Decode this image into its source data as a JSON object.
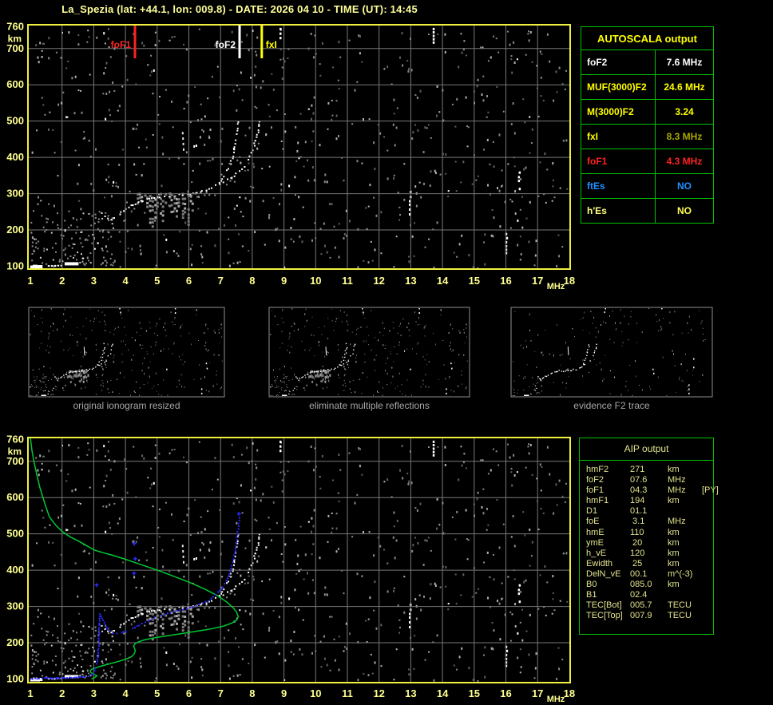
{
  "title": "La_Spezia (lat: +44.1, lon: 009.8) - DATE: 2026 04 10 - TIME (UT): 14:45",
  "colors": {
    "background": "#000000",
    "plot_border": "#F0F040",
    "grid": "#787878",
    "axis_text": "#FFFF90",
    "title_text": "#FFFF99",
    "caption_text": "#A6A6A6",
    "table_border": "#00C000",
    "green_profile": "#00C832",
    "blue_trace": "#2A2AFF",
    "trace_white": "#FFFFFF",
    "thumb_border": "#909090"
  },
  "axes": {
    "x_tick_labels": [
      "1",
      "2",
      "3",
      "4",
      "5",
      "6",
      "7",
      "8",
      "9",
      "10",
      "11",
      "12",
      "13",
      "14",
      "15",
      "16",
      "17",
      "18"
    ],
    "y_tick_labels": [
      "760",
      "700",
      "600",
      "500",
      "400",
      "300",
      "200",
      "100"
    ],
    "x_unit": "MHz",
    "y_unit": "km"
  },
  "autoscala": {
    "title": "AUTOSCALA output",
    "rows": [
      {
        "label": "foF2",
        "value": "7.6 MHz",
        "label_color": "#FFFFFF",
        "value_color": "#FFFFFF"
      },
      {
        "label": "MUF(3000)F2",
        "value": "24.6 MHz",
        "label_color": "#FFFF00",
        "value_color": "#FFFF00"
      },
      {
        "label": "M(3000)F2",
        "value": "3.24",
        "label_color": "#FFFF00",
        "value_color": "#FFFF00"
      },
      {
        "label": "fxI",
        "value": "8.3 MHz",
        "label_color": "#FFFF00",
        "value_color": "#A8A800"
      },
      {
        "label": "foF1",
        "value": "4.3 MHz",
        "label_color": "#FF2222",
        "value_color": "#FF2222"
      },
      {
        "label": "ftEs",
        "value": "NO",
        "label_color": "#1E90FF",
        "value_color": "#1E90FF"
      },
      {
        "label": "h'Es",
        "value": "NO",
        "label_color": "#FFFF80",
        "value_color": "#FFFF55"
      }
    ]
  },
  "aip": {
    "title": "AIP output",
    "rows": [
      {
        "label": "hmF2",
        "value": "271",
        "unit": "km",
        "extra": ""
      },
      {
        "label": "foF2",
        "value": "07.6",
        "unit": "MHz",
        "extra": ""
      },
      {
        "label": "foF1",
        "value": "04.3",
        "unit": "MHz",
        "extra": "[PY]"
      },
      {
        "label": "hmF1",
        "value": "194",
        "unit": "km",
        "extra": ""
      },
      {
        "label": "D1",
        "value": "01.1",
        "unit": "",
        "extra": ""
      },
      {
        "label": "foE",
        "value": " 3.1",
        "unit": "MHz",
        "extra": ""
      },
      {
        "label": "hmE",
        "value": "110",
        "unit": "km",
        "extra": ""
      },
      {
        "label": "ymE",
        "value": " 20",
        "unit": "km",
        "extra": ""
      },
      {
        "label": "h_vE",
        "value": "120",
        "unit": "km",
        "extra": ""
      },
      {
        "label": "Ewidth",
        "value": " 25",
        "unit": "km",
        "extra": ""
      },
      {
        "label": "DelN_vE",
        "value": "00.1",
        "unit": "m^(-3)",
        "extra": ""
      },
      {
        "label": "B0",
        "value": "085.0",
        "unit": "km",
        "extra": ""
      },
      {
        "label": "B1",
        "value": "02.4",
        "unit": "",
        "extra": ""
      },
      {
        "label": "TEC[Bot]",
        "value": "005.7",
        "unit": "TECU",
        "extra": ""
      },
      {
        "label": "TEC[Top]",
        "value": "007.9",
        "unit": "TECU",
        "extra": ""
      }
    ]
  },
  "thumbnails": [
    {
      "caption": "original ionogram resized"
    },
    {
      "caption": "eliminate multiple reflections"
    },
    {
      "caption": "evidence F2 trace"
    }
  ],
  "chart_data": [
    {
      "id": "main-ionogram",
      "type": "scatter",
      "title": "",
      "xlabel": "MHz",
      "ylabel": "km",
      "xlim": [
        1,
        18
      ],
      "ylim": [
        100,
        760
      ],
      "grid": true,
      "x_ticks": [
        1,
        2,
        3,
        4,
        5,
        6,
        7,
        8,
        9,
        10,
        11,
        12,
        13,
        14,
        15,
        16,
        17,
        18
      ],
      "y_ticks": [
        760,
        700,
        600,
        500,
        400,
        300,
        200,
        100
      ],
      "markers": [
        {
          "label": "foF1",
          "freq_mhz": 4.3,
          "color": "#FF2222",
          "label_side": "left"
        },
        {
          "label": "foF2",
          "freq_mhz": 7.6,
          "color": "#FFFFFF",
          "label_side": "left"
        },
        {
          "label": "fxI",
          "freq_mhz": 8.3,
          "color": "#FFFF00",
          "label_side": "right"
        }
      ],
      "series": {
        "e_blobs": [
          [
            1.02,
            100
          ],
          [
            1.1,
            102
          ],
          [
            1.18,
            100
          ],
          [
            1.26,
            101
          ]
        ],
        "e_dots": [
          [
            1.55,
            103
          ],
          [
            1.65,
            103
          ],
          [
            1.75,
            103
          ],
          [
            1.85,
            104
          ],
          [
            1.95,
            104
          ],
          [
            2.63,
            124
          ],
          [
            3.0,
            150
          ],
          [
            3.1,
            166
          ]
        ],
        "es_bar": {
          "f_start": 2.08,
          "f_end": 2.52,
          "km": 109
        },
        "f_trace": [
          [
            3.25,
            248
          ],
          [
            3.32,
            238
          ],
          [
            3.42,
            232
          ],
          [
            3.52,
            229
          ],
          [
            3.62,
            234
          ],
          [
            3.72,
            241
          ],
          [
            3.85,
            250
          ],
          [
            4.0,
            260
          ],
          [
            4.15,
            268
          ],
          [
            4.3,
            275
          ],
          [
            4.45,
            281
          ],
          [
            4.6,
            286
          ],
          [
            4.75,
            289
          ],
          [
            4.9,
            292
          ],
          [
            5.05,
            294
          ],
          [
            5.2,
            295
          ],
          [
            5.35,
            296
          ],
          [
            5.5,
            297
          ],
          [
            5.65,
            298
          ],
          [
            5.8,
            299
          ],
          [
            5.95,
            300
          ],
          [
            6.1,
            302
          ],
          [
            6.25,
            305
          ],
          [
            6.4,
            308
          ],
          [
            6.55,
            313
          ],
          [
            6.7,
            319
          ],
          [
            6.82,
            326
          ],
          [
            6.94,
            334
          ],
          [
            7.05,
            344
          ],
          [
            7.15,
            357
          ],
          [
            7.24,
            373
          ],
          [
            7.32,
            392
          ],
          [
            7.39,
            414
          ],
          [
            7.45,
            440
          ],
          [
            7.49,
            466
          ],
          [
            7.52,
            492
          ],
          [
            7.54,
            510
          ]
        ],
        "x_trace": [
          [
            6.95,
            330
          ],
          [
            7.12,
            337
          ],
          [
            7.3,
            346
          ],
          [
            7.48,
            357
          ],
          [
            7.64,
            370
          ],
          [
            7.78,
            386
          ],
          [
            7.9,
            404
          ],
          [
            8.0,
            424
          ],
          [
            8.09,
            448
          ],
          [
            8.16,
            472
          ],
          [
            8.21,
            494
          ],
          [
            8.24,
            510
          ]
        ],
        "second_hop": [
          [
            5.78,
            470
          ],
          [
            5.79,
            455
          ],
          [
            5.8,
            440
          ],
          [
            5.81,
            425
          ]
        ],
        "stripe_band": {
          "f_min": 4.3,
          "f_max": 6.15,
          "count": 22,
          "km_top_min": 286,
          "km_top_max": 304,
          "len_min": 25,
          "len_max": 85
        },
        "artifacts": [
          {
            "f": 13.69,
            "km1": 718,
            "km2": 757
          },
          {
            "f": 8.86,
            "km1": 728,
            "km2": 757
          },
          {
            "f": 12.94,
            "km1": 237,
            "km2": 308
          },
          {
            "f": 16.38,
            "km1": 300,
            "km2": 385
          },
          {
            "f": 15.98,
            "km1": 122,
            "km2": 192
          }
        ]
      }
    },
    {
      "id": "profile-plot",
      "type": "scatter",
      "note": "same ionogram scatter as main plot, with AIP model overlays",
      "xlim": [
        1,
        18
      ],
      "ylim": [
        100,
        760
      ],
      "x_ticks": [
        1,
        2,
        3,
        4,
        5,
        6,
        7,
        8,
        9,
        10,
        11,
        12,
        13,
        14,
        15,
        16,
        17,
        18
      ],
      "y_ticks": [
        760,
        700,
        600,
        500,
        400,
        300,
        200,
        100
      ],
      "overlays": {
        "green_profile_topside": [
          [
            1.0,
            766
          ],
          [
            1.05,
            730
          ],
          [
            1.1,
            705
          ],
          [
            1.2,
            665
          ],
          [
            1.3,
            628
          ],
          [
            1.45,
            585
          ],
          [
            1.6,
            547
          ],
          [
            1.8,
            524
          ],
          [
            2.0,
            507
          ],
          [
            2.25,
            492
          ],
          [
            2.5,
            481
          ],
          [
            2.75,
            469
          ],
          [
            3.0,
            456
          ],
          [
            3.3,
            448
          ],
          [
            3.6,
            441
          ],
          [
            4.0,
            430
          ],
          [
            4.5,
            415
          ],
          [
            5.0,
            400
          ],
          [
            5.5,
            384
          ],
          [
            6.0,
            367
          ],
          [
            6.5,
            348
          ],
          [
            6.9,
            330
          ],
          [
            7.2,
            312
          ],
          [
            7.4,
            296
          ],
          [
            7.5,
            285
          ],
          [
            7.56,
            272
          ]
        ],
        "green_profile_bottomside": [
          [
            7.56,
            272
          ],
          [
            7.5,
            262
          ],
          [
            7.35,
            254
          ],
          [
            7.1,
            246
          ],
          [
            6.7,
            238
          ],
          [
            6.2,
            231
          ],
          [
            5.6,
            223
          ],
          [
            5.0,
            215
          ],
          [
            4.6,
            208
          ],
          [
            4.4,
            202
          ],
          [
            4.3,
            197
          ],
          [
            4.26,
            191
          ],
          [
            4.29,
            184
          ],
          [
            4.31,
            177
          ],
          [
            4.27,
            169
          ],
          [
            4.2,
            162
          ],
          [
            4.05,
            156
          ],
          [
            3.8,
            149
          ],
          [
            3.5,
            142
          ],
          [
            3.25,
            136
          ],
          [
            3.05,
            131
          ],
          [
            2.94,
            127
          ],
          [
            2.89,
            123
          ],
          [
            2.91,
            118
          ],
          [
            2.98,
            114
          ],
          [
            3.06,
            111
          ],
          [
            3.1,
            109
          ],
          [
            3.04,
            105
          ],
          [
            2.97,
            102
          ],
          [
            2.93,
            100
          ]
        ],
        "blue_trace_e": [
          [
            1.0,
            103
          ],
          [
            1.12,
            103
          ],
          [
            1.24,
            103
          ],
          [
            1.36,
            104
          ],
          [
            1.48,
            104
          ],
          [
            1.6,
            104
          ],
          [
            1.72,
            104
          ],
          [
            1.84,
            105
          ],
          [
            1.96,
            105
          ],
          [
            2.08,
            105
          ],
          [
            2.2,
            106
          ],
          [
            2.32,
            106
          ],
          [
            2.44,
            107
          ],
          [
            2.56,
            107
          ],
          [
            2.68,
            108
          ],
          [
            2.8,
            110
          ],
          [
            2.9,
            113
          ],
          [
            2.97,
            118
          ],
          [
            3.02,
            126
          ],
          [
            3.06,
            136
          ],
          [
            3.09,
            150
          ],
          [
            3.11,
            168
          ],
          [
            3.13,
            192
          ],
          [
            3.14,
            220
          ],
          [
            3.15,
            250
          ],
          [
            3.16,
            275
          ],
          [
            3.17,
            285
          ]
        ],
        "blue_trace_f": [
          [
            3.22,
            276
          ],
          [
            3.3,
            258
          ],
          [
            3.38,
            245
          ],
          [
            3.48,
            235
          ],
          [
            3.58,
            229
          ],
          [
            3.7,
            227
          ],
          [
            3.85,
            229
          ],
          [
            4.0,
            234
          ],
          [
            4.2,
            242
          ],
          [
            4.4,
            251
          ],
          [
            4.6,
            259
          ],
          [
            4.8,
            267
          ],
          [
            5.0,
            274
          ],
          [
            5.2,
            280
          ],
          [
            5.4,
            285
          ],
          [
            5.6,
            290
          ],
          [
            5.8,
            294
          ],
          [
            6.0,
            299
          ],
          [
            6.2,
            304
          ],
          [
            6.4,
            311
          ],
          [
            6.6,
            319
          ],
          [
            6.75,
            329
          ],
          [
            6.9,
            341
          ],
          [
            7.05,
            356
          ],
          [
            7.15,
            372
          ],
          [
            7.25,
            392
          ],
          [
            7.33,
            416
          ],
          [
            7.4,
            442
          ],
          [
            7.46,
            470
          ],
          [
            7.51,
            500
          ],
          [
            7.55,
            530
          ],
          [
            7.58,
            556
          ]
        ],
        "blue_marks": [
          [
            4.27,
            474
          ],
          [
            4.3,
            432
          ],
          [
            4.26,
            392
          ],
          [
            3.08,
            360
          ],
          [
            7.57,
            556
          ]
        ]
      }
    }
  ]
}
